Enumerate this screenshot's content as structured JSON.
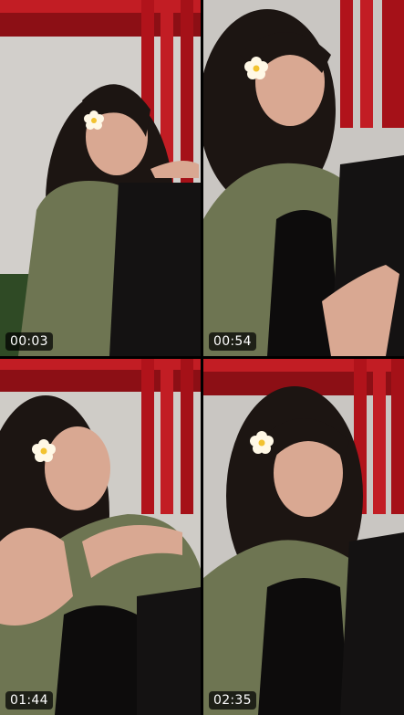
{
  "clips": [
    {
      "timestamp": "00:03",
      "flower_icon": "plumeria-flower-icon"
    },
    {
      "timestamp": "00:54",
      "flower_icon": "plumeria-flower-icon"
    },
    {
      "timestamp": "01:44",
      "flower_icon": "plumeria-flower-icon"
    },
    {
      "timestamp": "02:35",
      "flower_icon": "plumeria-flower-icon"
    }
  ],
  "colors": {
    "wall": "#c9c6c2",
    "red_frame": "#b1131b",
    "jacket": "#6e7552",
    "hair": "#1c1512",
    "skin": "#d9a892",
    "top": "#0d0c0c",
    "timestamp_bg": "rgba(0,0,0,0.72)"
  }
}
